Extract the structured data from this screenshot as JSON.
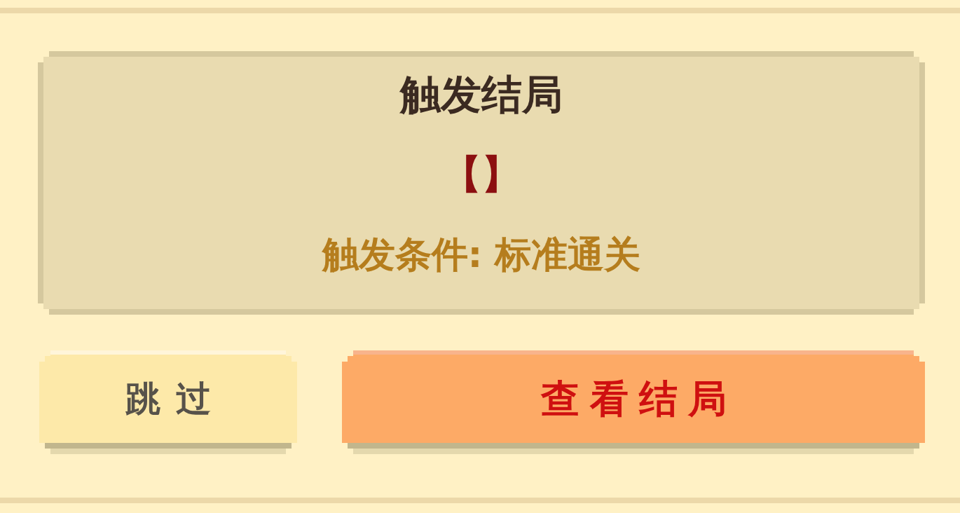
{
  "panel": {
    "title": "触发结局",
    "ending_name": "【】",
    "condition": "触发条件: 标准通关"
  },
  "buttons": [
    {
      "label": "跳过",
      "kind": "secondary"
    },
    {
      "label": "查看结局",
      "kind": "primary"
    }
  ]
}
